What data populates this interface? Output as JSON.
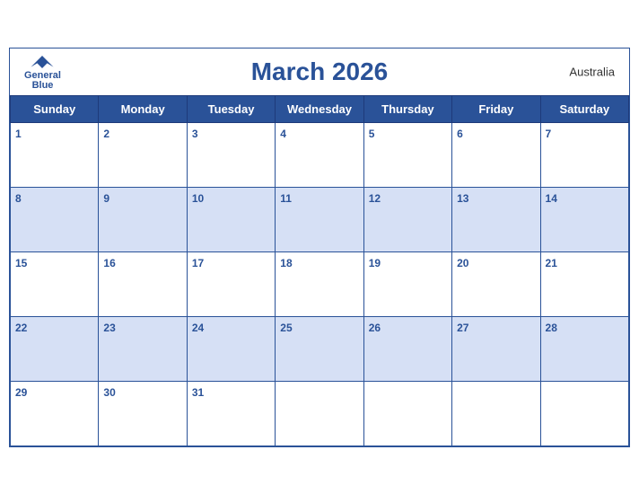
{
  "header": {
    "title": "March 2026",
    "country": "Australia",
    "logo": {
      "general": "General",
      "blue": "Blue"
    }
  },
  "weekdays": [
    "Sunday",
    "Monday",
    "Tuesday",
    "Wednesday",
    "Thursday",
    "Friday",
    "Saturday"
  ],
  "weeks": [
    [
      {
        "day": 1,
        "shaded": false
      },
      {
        "day": 2,
        "shaded": false
      },
      {
        "day": 3,
        "shaded": false
      },
      {
        "day": 4,
        "shaded": false
      },
      {
        "day": 5,
        "shaded": false
      },
      {
        "day": 6,
        "shaded": false
      },
      {
        "day": 7,
        "shaded": false
      }
    ],
    [
      {
        "day": 8,
        "shaded": true
      },
      {
        "day": 9,
        "shaded": true
      },
      {
        "day": 10,
        "shaded": true
      },
      {
        "day": 11,
        "shaded": true
      },
      {
        "day": 12,
        "shaded": true
      },
      {
        "day": 13,
        "shaded": true
      },
      {
        "day": 14,
        "shaded": true
      }
    ],
    [
      {
        "day": 15,
        "shaded": false
      },
      {
        "day": 16,
        "shaded": false
      },
      {
        "day": 17,
        "shaded": false
      },
      {
        "day": 18,
        "shaded": false
      },
      {
        "day": 19,
        "shaded": false
      },
      {
        "day": 20,
        "shaded": false
      },
      {
        "day": 21,
        "shaded": false
      }
    ],
    [
      {
        "day": 22,
        "shaded": true
      },
      {
        "day": 23,
        "shaded": true
      },
      {
        "day": 24,
        "shaded": true
      },
      {
        "day": 25,
        "shaded": true
      },
      {
        "day": 26,
        "shaded": true
      },
      {
        "day": 27,
        "shaded": true
      },
      {
        "day": 28,
        "shaded": true
      }
    ],
    [
      {
        "day": 29,
        "shaded": false
      },
      {
        "day": 30,
        "shaded": false
      },
      {
        "day": 31,
        "shaded": false
      },
      {
        "day": null,
        "shaded": false
      },
      {
        "day": null,
        "shaded": false
      },
      {
        "day": null,
        "shaded": false
      },
      {
        "day": null,
        "shaded": false
      }
    ]
  ]
}
